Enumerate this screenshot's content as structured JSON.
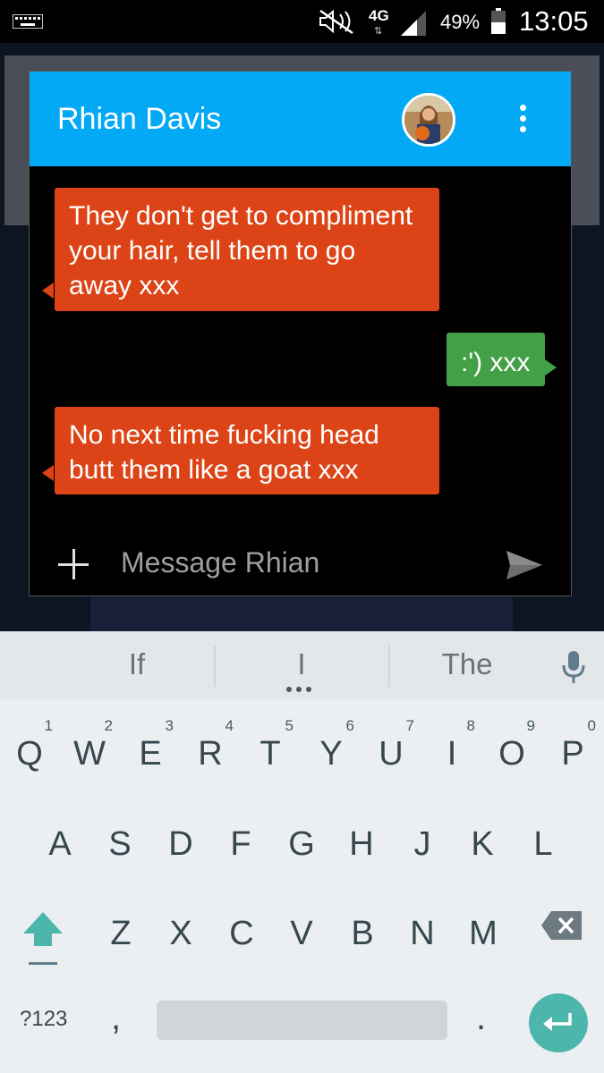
{
  "status_bar": {
    "network": "4G",
    "battery_percent": "49%",
    "time": "13:05",
    "icons": [
      "keyboard-icon",
      "mute-icon",
      "signal-icon",
      "battery-icon"
    ]
  },
  "chat": {
    "contact_name": "Rhian Davis",
    "messages": [
      {
        "direction": "incoming",
        "text": "They don't get to compliment your hair, tell them to go away xxx"
      },
      {
        "direction": "outgoing",
        "text": ":') xxx"
      },
      {
        "direction": "incoming",
        "text": "No next time fucking head butt them like a goat xxx"
      }
    ],
    "compose": {
      "placeholder": "Message Rhian"
    },
    "colors": {
      "header": "#03a9f4",
      "incoming": "#dc4417",
      "outgoing": "#43a047"
    }
  },
  "keyboard": {
    "suggestions": [
      "If",
      "I",
      "The"
    ],
    "row1": [
      {
        "key": "Q",
        "hint": "1"
      },
      {
        "key": "W",
        "hint": "2"
      },
      {
        "key": "E",
        "hint": "3"
      },
      {
        "key": "R",
        "hint": "4"
      },
      {
        "key": "T",
        "hint": "5"
      },
      {
        "key": "Y",
        "hint": "6"
      },
      {
        "key": "U",
        "hint": "7"
      },
      {
        "key": "I",
        "hint": "8"
      },
      {
        "key": "O",
        "hint": "9"
      },
      {
        "key": "P",
        "hint": "0"
      }
    ],
    "row2": [
      "A",
      "S",
      "D",
      "F",
      "G",
      "H",
      "J",
      "K",
      "L"
    ],
    "row3": [
      "Z",
      "X",
      "C",
      "V",
      "B",
      "N",
      "M"
    ],
    "symbols_label": "?123",
    "comma": ",",
    "period": ".",
    "accent_color": "#4db6ac"
  }
}
